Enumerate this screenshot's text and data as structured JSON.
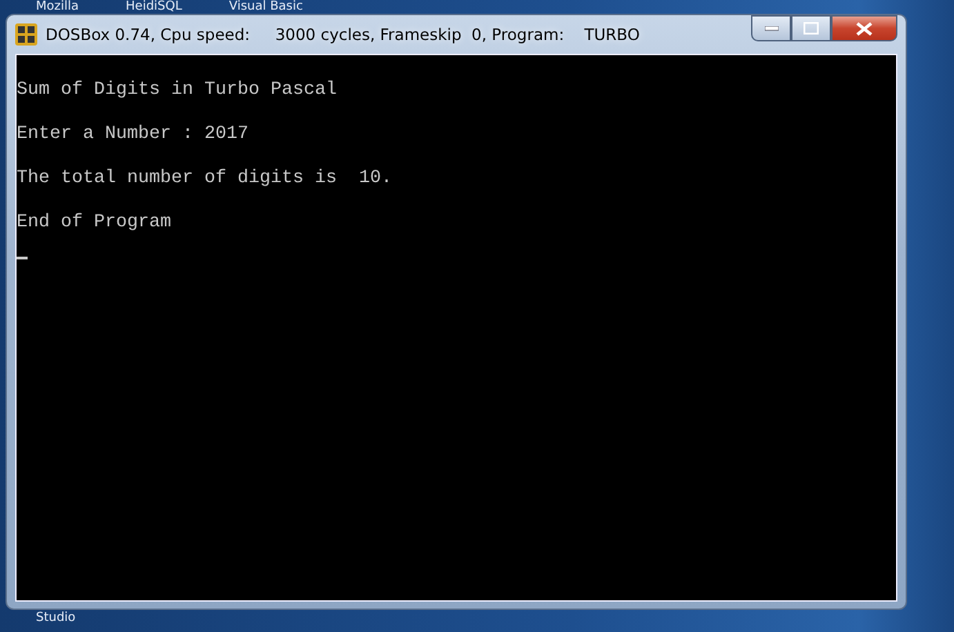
{
  "desktop": {
    "icon_labels": [
      "Mozilla",
      "HeidiSQL",
      "Visual Basic"
    ],
    "bottom_labels": [
      "Studio"
    ]
  },
  "window": {
    "title": "DOSBox 0.74, Cpu speed:     3000 cycles, Frameskip  0, Program:    TURBO"
  },
  "console": {
    "lines": [
      "Sum of Digits in Turbo Pascal",
      "Enter a Number : 2017",
      "The total number of digits is  10.",
      "End of Program"
    ],
    "cursor": true
  }
}
